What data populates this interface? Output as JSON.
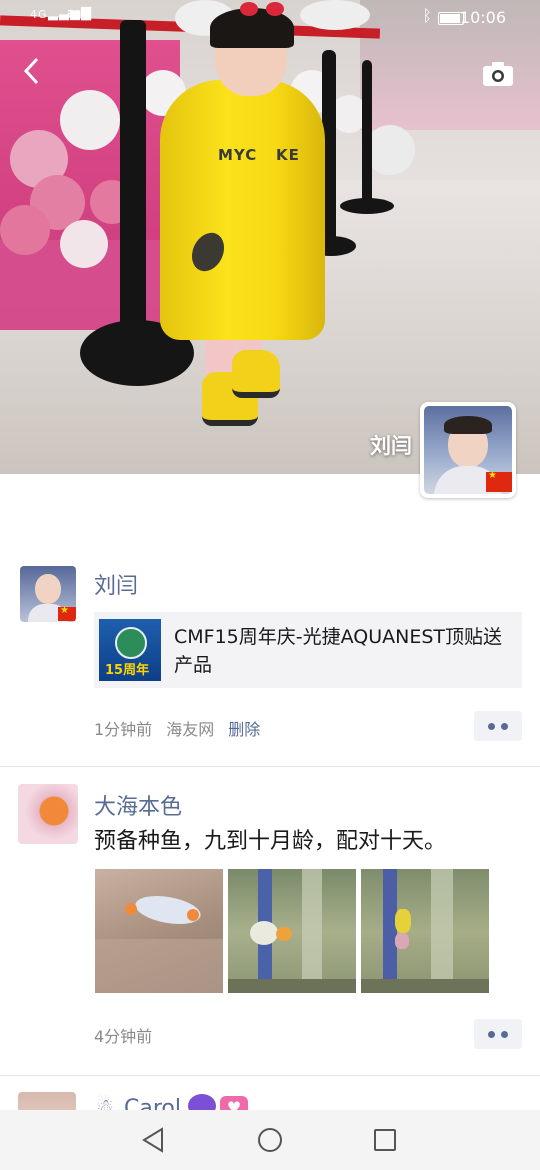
{
  "status_bar": {
    "network": "4G",
    "time": "10:06"
  },
  "cover": {
    "owner_name": "刘闫"
  },
  "posts": [
    {
      "author": "刘闫",
      "link_thumb_text": "15周年",
      "link_title": "CMF15周年庆-光捷AQUANEST顶贴送产品",
      "time": "1分钟前",
      "source": "海友网",
      "delete_label": "删除"
    },
    {
      "author": "大海本色",
      "text": "预备种鱼，九到十月龄，配对十天。",
      "time": "4分钟前",
      "photo_count": 3
    },
    {
      "author": "Carol"
    }
  ],
  "icons": {
    "back": "chevron-left-icon",
    "camera": "camera-icon",
    "more": "more-dots-icon",
    "nav_back": "triangle-back-icon",
    "nav_home": "circle-home-icon",
    "nav_recents": "square-recents-icon"
  },
  "colors": {
    "nickname": "#576b95",
    "meta": "#8a8a8a",
    "nav_bg": "#f4f4f4"
  }
}
